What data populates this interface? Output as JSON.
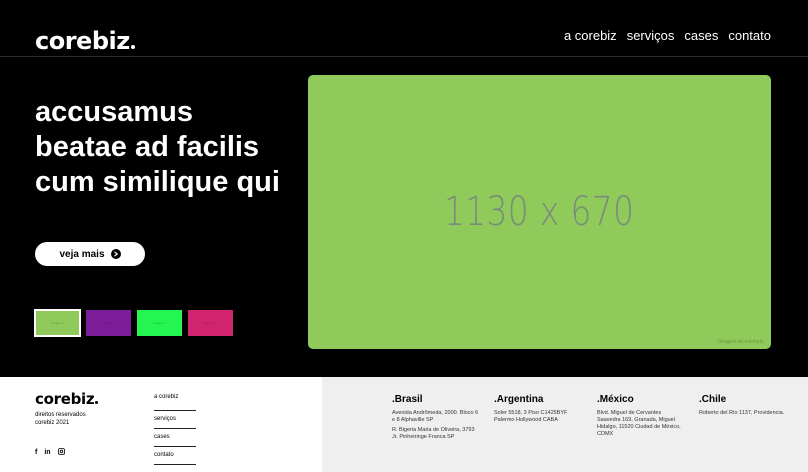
{
  "header": {
    "logo": "corebiz",
    "nav": [
      "a corebiz",
      "serviços",
      "cases",
      "contato"
    ]
  },
  "hero": {
    "headline": "accusamus beatae ad facilis cum similique qui",
    "cta_label": "veja mais",
    "image": {
      "text": "1130 x 670",
      "credit": "Imagem do exemplo.",
      "color": "#8fca5a"
    },
    "thumbnails": [
      {
        "color": "#8fca5a",
        "text": "Imagem 1",
        "active": true
      },
      {
        "color": "#7e1d9a",
        "text": "Imagem 2",
        "active": false
      },
      {
        "color": "#25f550",
        "text": "Imagem 3",
        "active": false
      },
      {
        "color": "#d1246f",
        "text": "Imagem 4",
        "active": false
      }
    ]
  },
  "footer": {
    "logo": "corebiz",
    "rights_line1": "direitos reservados",
    "rights_line2": "corebiz 2021",
    "social": [
      "f",
      "in",
      "ig"
    ],
    "links": [
      "a corebiz",
      "serviços",
      "cases",
      "contato"
    ],
    "offices": [
      {
        "country": ".Brasil",
        "addresses": [
          "Avenida Andrômeda, 2000. Bloco 6 e 8 Alphaville SP",
          "R. Bigeria Maria de Oliveira, 3793 Jr. Pinheiringe Franca SP"
        ]
      },
      {
        "country": ".Argentina",
        "addresses": [
          "Soler 5518, 3 Piso C1425BYF Palermo Hollywood CABA"
        ]
      },
      {
        "country": ".México",
        "addresses": [
          "Blvd. Miguel de Cervantes Saavedra 169, Granada, Miguel Hidalgo, 11520 Ciudad de México, CDMX"
        ]
      },
      {
        "country": ".Chile",
        "addresses": [
          "Roberto del Río 1137, Providencia."
        ]
      }
    ]
  },
  "colors": {
    "background": "#000000",
    "footer_left": "#ffffff",
    "footer_right": "#efefef"
  }
}
